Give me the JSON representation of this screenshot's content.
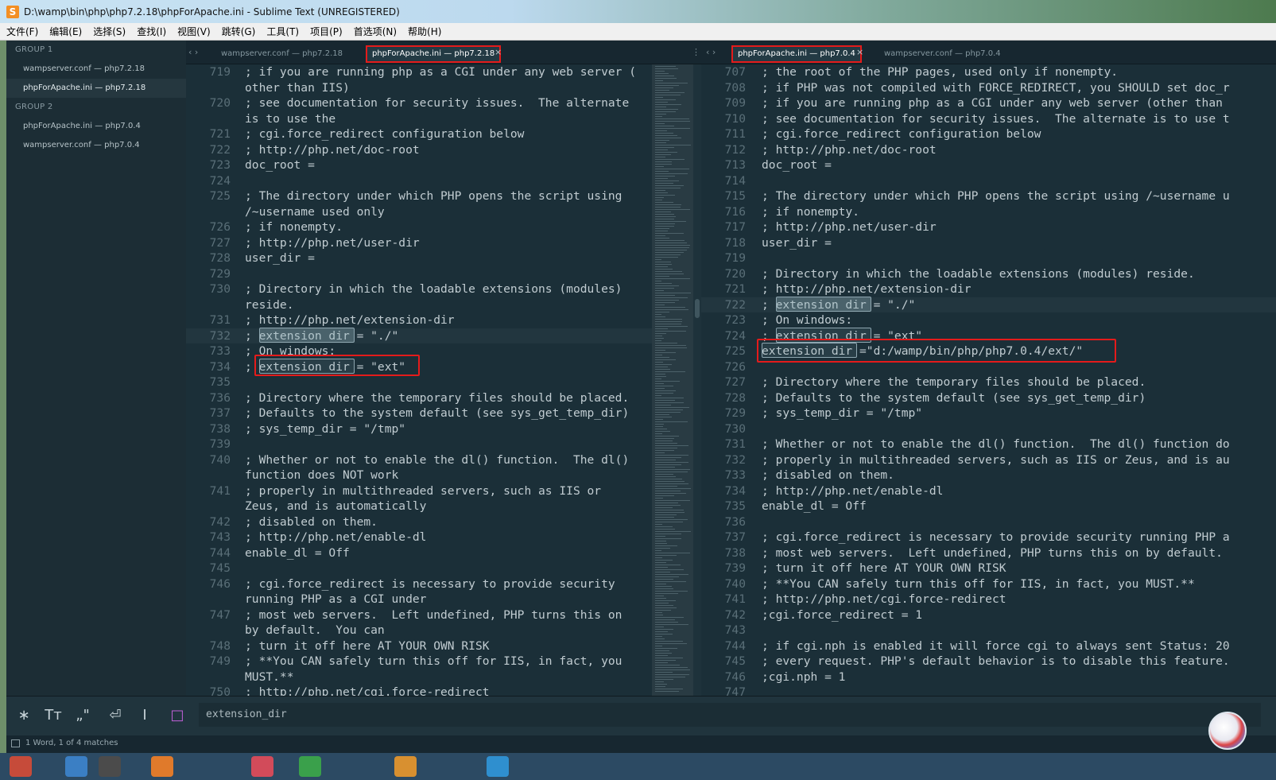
{
  "window": {
    "title": "D:\\wamp\\bin\\php\\php7.2.18\\phpForApache.ini - Sublime Text (UNREGISTERED)",
    "app_icon": "S"
  },
  "menu": [
    "文件(F)",
    "编辑(E)",
    "选择(S)",
    "查找(I)",
    "视图(V)",
    "跳转(G)",
    "工具(T)",
    "项目(P)",
    "首选项(N)",
    "帮助(H)"
  ],
  "sidebar": {
    "group1": "GROUP 1",
    "group1_files": [
      "wampserver.conf — php7.2.18",
      "phpForApache.ini — php7.2.18"
    ],
    "group2": "GROUP 2",
    "group2_files": [
      "phpForApache.ini — php7.0.4",
      "wampserver.conf — php7.0.4"
    ]
  },
  "left_pane": {
    "nav": "‹  ›",
    "tabs": [
      "wampserver.conf — php7.2.18",
      "phpForApache.ini — php7.2.18"
    ],
    "active_tab": 1,
    "close": "×",
    "more": "⋮",
    "lines": [
      {
        "n": "719",
        "t": "; if you are running php as a CGI under any web server ("
      },
      {
        "n": "",
        "t": "other than IIS)"
      },
      {
        "n": "720",
        "t": "; see documentation for security issues.  The alternate"
      },
      {
        "n": "",
        "t": "is to use the"
      },
      {
        "n": "721",
        "t": "; cgi.force_redirect configuration below"
      },
      {
        "n": "722",
        "t": "; http://php.net/doc-root"
      },
      {
        "n": "723",
        "t": "doc_root ="
      },
      {
        "n": "724",
        "t": ""
      },
      {
        "n": "725",
        "t": "; The directory under which PHP opens the script using"
      },
      {
        "n": "",
        "t": "/~username used only"
      },
      {
        "n": "726",
        "t": "; if nonempty."
      },
      {
        "n": "727",
        "t": "; http://php.net/user-dir"
      },
      {
        "n": "728",
        "t": "user_dir ="
      },
      {
        "n": "729",
        "t": ""
      },
      {
        "n": "730",
        "t": "; Directory in which the loadable extensions (modules)"
      },
      {
        "n": "",
        "t": "reside."
      },
      {
        "n": "731",
        "t": "; http://php.net/extension-dir"
      },
      {
        "n": "732",
        "t": "; extension_dir = \"./\""
      },
      {
        "n": "733",
        "t": "; On windows:"
      },
      {
        "n": "734",
        "t": "; extension_dir = \"ext\""
      },
      {
        "n": "735",
        "t": ""
      },
      {
        "n": "736",
        "t": "; Directory where the temporary files should be placed."
      },
      {
        "n": "737",
        "t": "; Defaults to the system default (see sys_get_temp_dir)"
      },
      {
        "n": "738",
        "t": "; sys_temp_dir = \"/tmp\""
      },
      {
        "n": "739",
        "t": ""
      },
      {
        "n": "740",
        "t": "; Whether or not to enable the dl() function.  The dl()"
      },
      {
        "n": "",
        "t": "function does NOT work"
      },
      {
        "n": "741",
        "t": "; properly in multithreaded servers, such as IIS or"
      },
      {
        "n": "",
        "t": "Zeus, and is automatically"
      },
      {
        "n": "742",
        "t": "; disabled on them."
      },
      {
        "n": "743",
        "t": "; http://php.net/enable-dl"
      },
      {
        "n": "744",
        "t": "enable_dl = Off"
      },
      {
        "n": "745",
        "t": ""
      },
      {
        "n": "746",
        "t": "; cgi.force_redirect is necessary to provide security"
      },
      {
        "n": "",
        "t": "running PHP as a CGI under"
      },
      {
        "n": "747",
        "t": "; most web servers.  Left undefined, PHP turns this on"
      },
      {
        "n": "",
        "t": "by default.  You can"
      },
      {
        "n": "748",
        "t": "; turn it off here AT YOUR OWN RISK"
      },
      {
        "n": "749",
        "t": "; **You CAN safely turn this off for IIS, in fact, you"
      },
      {
        "n": "",
        "t": "MUST.**"
      },
      {
        "n": "750",
        "t": "; http://php.net/cgi.force-redirect"
      }
    ]
  },
  "right_pane": {
    "nav": "‹  ›",
    "tabs": [
      "phpForApache.ini — php7.0.4",
      "wampserver.conf — php7.0.4"
    ],
    "active_tab": 0,
    "close": "×",
    "lines": [
      {
        "n": "707",
        "t": "; the root of the PHP pages, used only if nonempty."
      },
      {
        "n": "708",
        "t": "; if PHP was not compiled with FORCE_REDIRECT, you SHOULD set doc_r"
      },
      {
        "n": "709",
        "t": "; if you are running php as a CGI under any web server (other than"
      },
      {
        "n": "710",
        "t": "; see documentation for security issues.  The alternate is to use t"
      },
      {
        "n": "711",
        "t": "; cgi.force_redirect configuration below"
      },
      {
        "n": "712",
        "t": "; http://php.net/doc-root"
      },
      {
        "n": "713",
        "t": "doc_root ="
      },
      {
        "n": "714",
        "t": ""
      },
      {
        "n": "715",
        "t": "; The directory under which PHP opens the script using /~username u"
      },
      {
        "n": "716",
        "t": "; if nonempty."
      },
      {
        "n": "717",
        "t": "; http://php.net/user-dir"
      },
      {
        "n": "718",
        "t": "user_dir ="
      },
      {
        "n": "719",
        "t": ""
      },
      {
        "n": "720",
        "t": "; Directory in which the loadable extensions (modules) reside."
      },
      {
        "n": "721",
        "t": "; http://php.net/extension-dir"
      },
      {
        "n": "722",
        "t": "; extension_dir = \"./\""
      },
      {
        "n": "723",
        "t": "; On windows:"
      },
      {
        "n": "724",
        "t": "; extension_dir = \"ext\""
      },
      {
        "n": "725",
        "t": "extension_dir =\"d:/wamp/bin/php/php7.0.4/ext/\""
      },
      {
        "n": "726",
        "t": ""
      },
      {
        "n": "727",
        "t": "; Directory where the temporary files should be placed."
      },
      {
        "n": "728",
        "t": "; Defaults to the system default (see sys_get_temp_dir)"
      },
      {
        "n": "729",
        "t": "; sys_temp_dir = \"/tmp\""
      },
      {
        "n": "730",
        "t": ""
      },
      {
        "n": "731",
        "t": "; Whether or not to enable the dl() function.  The dl() function do"
      },
      {
        "n": "732",
        "t": "; properly in multithreaded servers, such as IIS or Zeus, and is au"
      },
      {
        "n": "733",
        "t": "; disabled on them."
      },
      {
        "n": "734",
        "t": "; http://php.net/enable-dl"
      },
      {
        "n": "735",
        "t": "enable_dl = Off"
      },
      {
        "n": "736",
        "t": ""
      },
      {
        "n": "737",
        "t": "; cgi.force_redirect is necessary to provide security running PHP a"
      },
      {
        "n": "738",
        "t": "; most web servers.  Left undefined, PHP turns this on by default."
      },
      {
        "n": "739",
        "t": "; turn it off here AT YOUR OWN RISK"
      },
      {
        "n": "740",
        "t": "; **You CAN safely turn this off for IIS, in fact, you MUST.**"
      },
      {
        "n": "741",
        "t": "; http://php.net/cgi.force-redirect"
      },
      {
        "n": "742",
        "t": ";cgi.force_redirect = 1"
      },
      {
        "n": "743",
        "t": ""
      },
      {
        "n": "744",
        "t": "; if cgi.nph is enabled it will force cgi to always sent Status: 20"
      },
      {
        "n": "745",
        "t": "; every request. PHP's default behavior is to disable this feature."
      },
      {
        "n": "746",
        "t": ";cgi.nph = 1"
      },
      {
        "n": "747",
        "t": ""
      }
    ]
  },
  "find": {
    "buttons": [
      "∗",
      "Tт",
      "„\"",
      "⏎",
      "I",
      "□"
    ],
    "query": "extension_dir"
  },
  "status": {
    "text": "1 Word, 1 of 4 matches"
  },
  "colors": {
    "editor_bg": "#1b2f38",
    "highlight_red": "#e41b1b",
    "selection_box": "#8ea6b0"
  }
}
